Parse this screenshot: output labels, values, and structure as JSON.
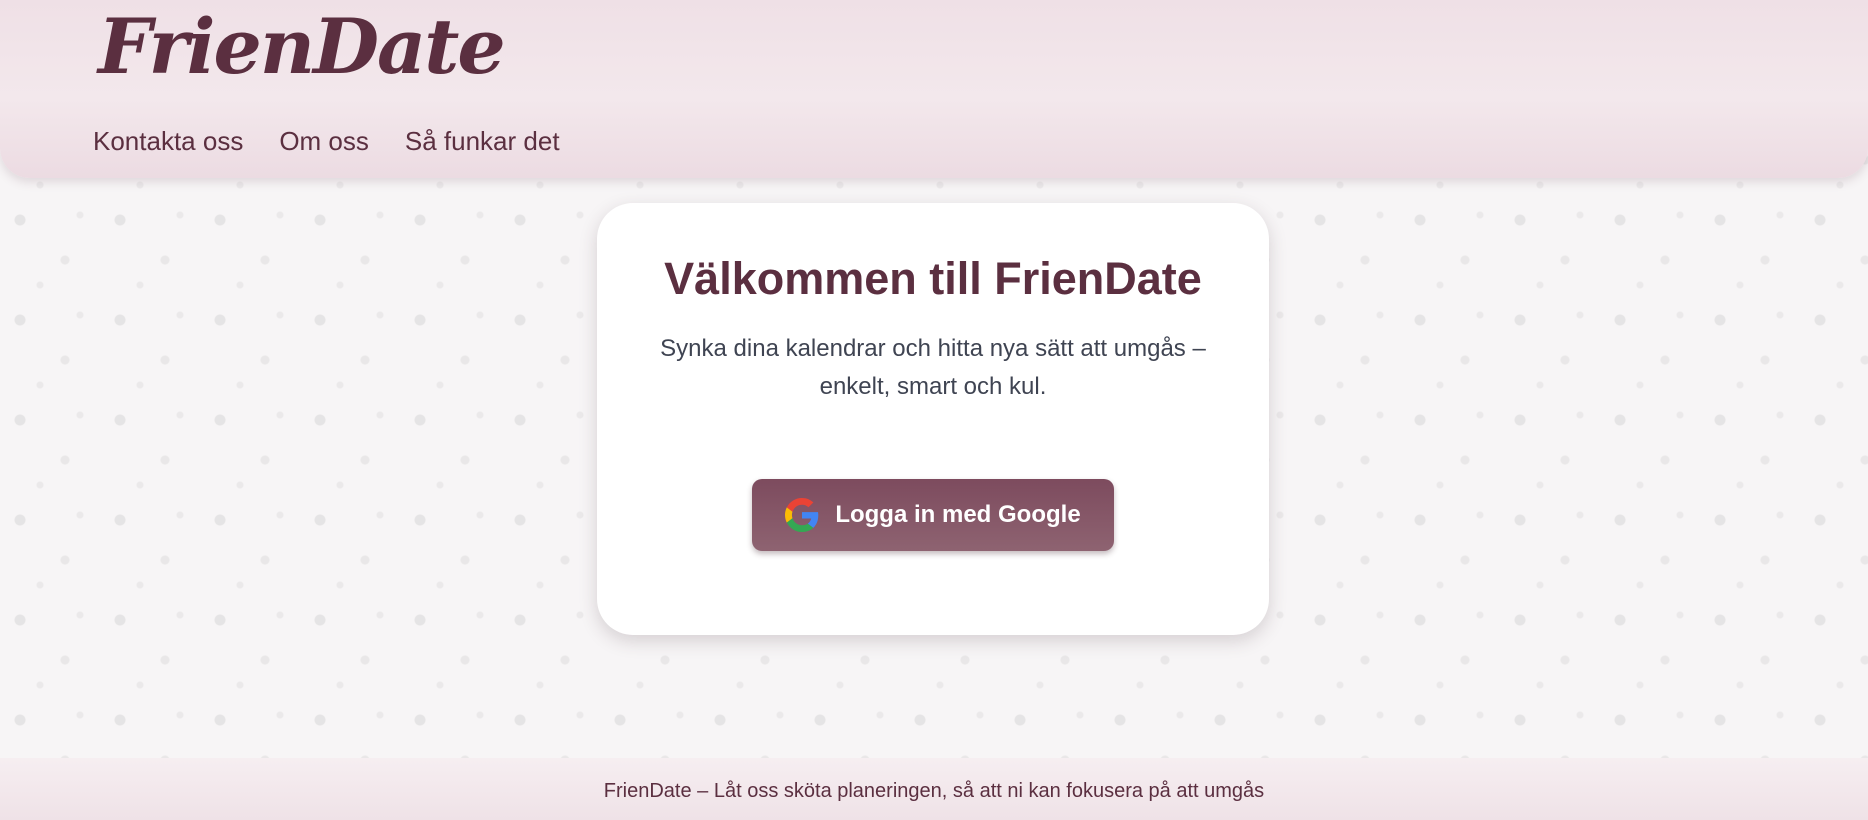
{
  "header": {
    "logo": "FrienDate",
    "nav": [
      {
        "label": "Kontakta oss"
      },
      {
        "label": "Om oss"
      },
      {
        "label": "Så funkar det"
      }
    ]
  },
  "card": {
    "title": "Välkommen till FrienDate",
    "description": "Synka dina kalendrar och hitta nya sätt att umgås – enkelt, smart och kul.",
    "login_button": {
      "label": "Logga in med Google",
      "icon": "google-icon"
    }
  },
  "footer": {
    "text": "FrienDate – Låt oss sköta planeringen, så att ni kan fokusera på att umgås"
  },
  "colors": {
    "brand": "#5b2f40",
    "button": "#7d4b5e",
    "card": "#ffffff",
    "header": "#efe0e6"
  }
}
